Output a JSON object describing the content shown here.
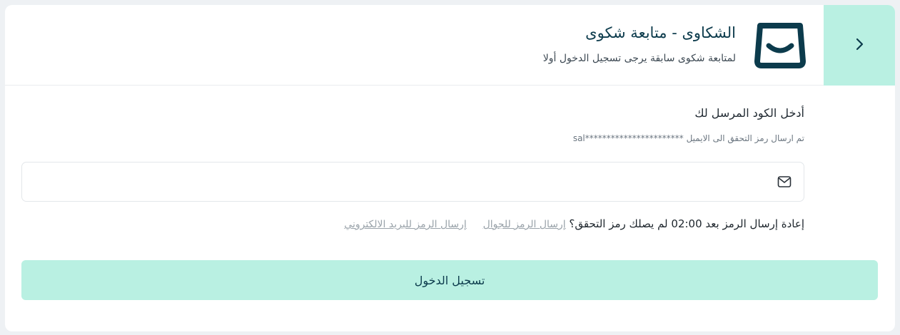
{
  "header": {
    "title": "الشكاوى - متابعة شكوى",
    "subtitle": "لمتابعة شكوى سابقة يرجى تسجيل الدخول أولا",
    "back_icon": "chevron-right-icon",
    "logo_icon": "smile-bag-logo"
  },
  "form": {
    "code_label": "أدخل الكود المرسل لك",
    "hint": "تم ارسال رمز التحقق الى الايميل ***********************sal",
    "code_value": "",
    "field_icon": "mail-icon"
  },
  "resend": {
    "text": "إعادة إرسال الرمز بعد 02:00 لم يصلك رمز التحقق؟",
    "sms_link": "إرسال الرمز للجوال",
    "email_link": "إرسال الرمز للبريد الالكتروني"
  },
  "submit": {
    "label": "تسجيل الدخول"
  },
  "colors": {
    "accent": "#b9f0e2",
    "primary_text": "#0c3b4c",
    "background": "#eef1f4"
  }
}
